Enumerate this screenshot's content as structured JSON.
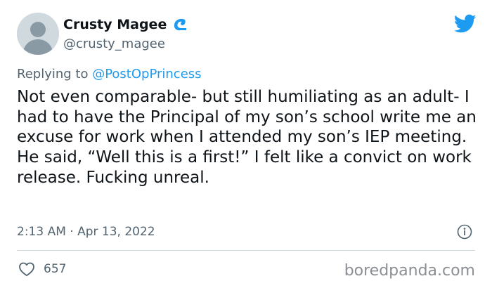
{
  "tweet": {
    "author": {
      "display_name": "Crusty Magee",
      "handle": "@crusty_magee",
      "name_badge_icon": "wave-icon"
    },
    "reply": {
      "prefix": "Replying to ",
      "mention": "@PostOpPrincess"
    },
    "text": "Not even comparable- but still humiliating as an adult- I had to have the Principal of my son’s school write me an excuse for work when I attended my son’s IEP meeting. He said, “Well this is a first!” I felt like a convict on work release. Fucking unreal.",
    "timestamp": "2:13 AM · Apr 13, 2022",
    "likes": "657"
  },
  "branding": {
    "platform_icon": "twitter-bird-icon",
    "watermark": "boredpanda.com"
  },
  "colors": {
    "accent": "#1d9bf0",
    "text_primary": "#0f1419",
    "text_secondary": "#536471",
    "divider": "#cfd9de",
    "wave": "#1d9bf0"
  }
}
